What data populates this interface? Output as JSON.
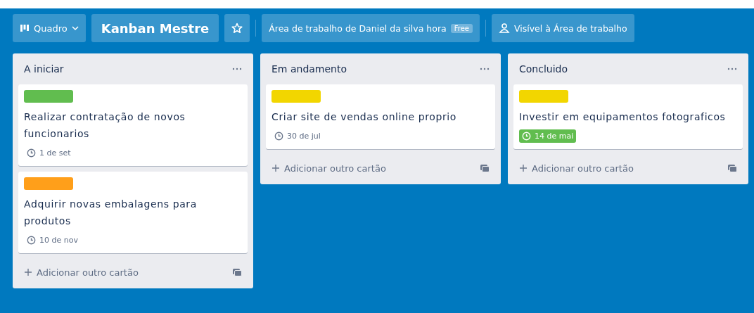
{
  "header": {
    "board_menu": "Quadro",
    "board_title": "Kanban Mestre",
    "starred": false,
    "workspace": "Área de trabalho de Daniel da silva hora",
    "plan_badge": "Free",
    "visibility": "Visível à Área de trabalho"
  },
  "lists": [
    {
      "title": "A iniciar",
      "add_label": "Adicionar outro cartão",
      "cards": [
        {
          "color": "#61bd4f",
          "title": "Realizar contratação de novos funcionarios",
          "due": "1 de set",
          "due_complete": false
        },
        {
          "color": "#ff9f1a",
          "title": "Adquirir novas embalagens para produtos",
          "due": "10 de nov",
          "due_complete": false
        }
      ]
    },
    {
      "title": "Em andamento",
      "add_label": "Adicionar outro cartão",
      "cards": [
        {
          "color": "#f2d600",
          "title": "Criar site de vendas online proprio",
          "due": "30 de jul",
          "due_complete": false
        }
      ]
    },
    {
      "title": "Concluido",
      "add_label": "Adicionar outro cartão",
      "cards": [
        {
          "color": "#f2d600",
          "title": "Investir em equipamentos fotograficos",
          "due": "14 de mai",
          "due_complete": true
        }
      ]
    }
  ]
}
